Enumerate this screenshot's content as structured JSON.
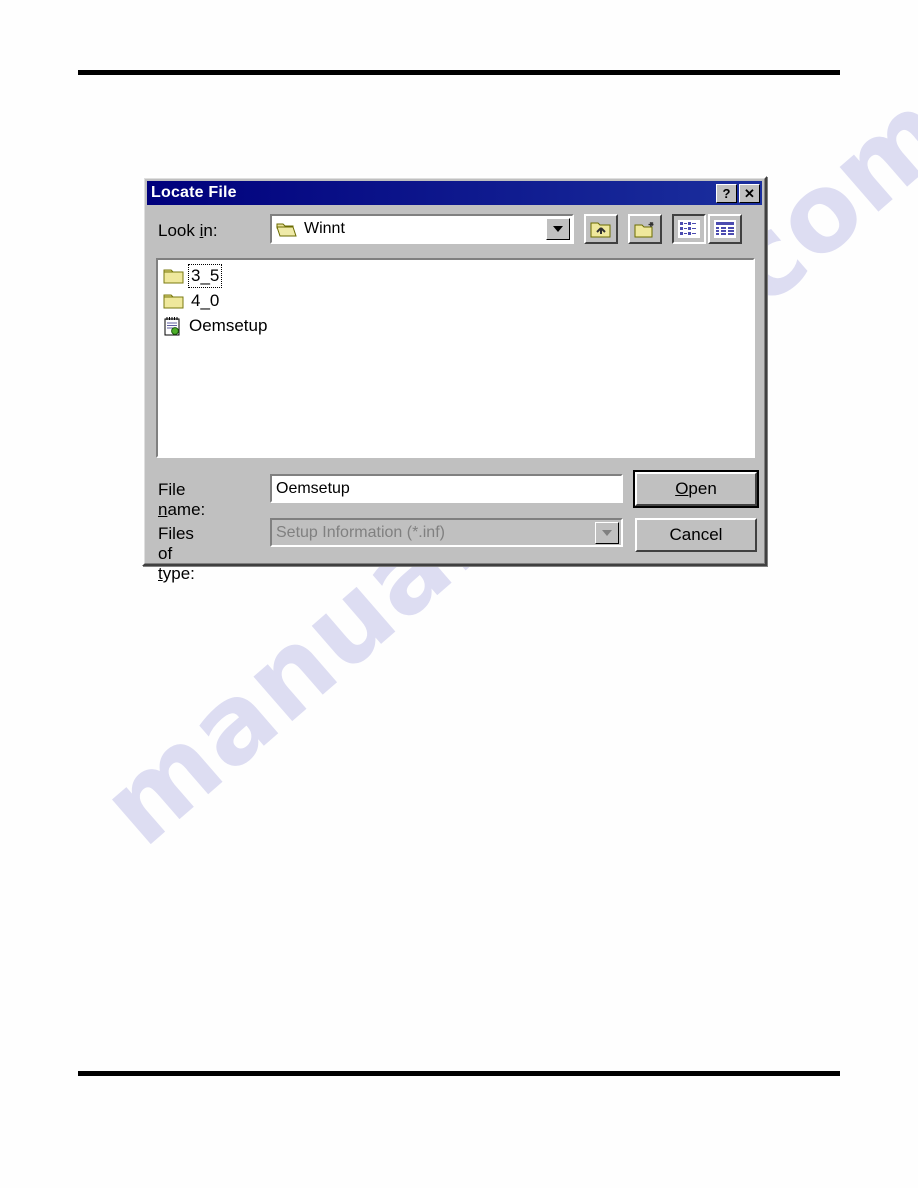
{
  "page": {
    "background_color": "#fefefe",
    "rule_color": "#000000",
    "watermark_text": "manualshive.com",
    "watermark_color": "#c9c9ec"
  },
  "dialog": {
    "title": "Locate File",
    "titlebar_color": "#000080",
    "face_color": "#c0c0c0",
    "titlebar_buttons": [
      {
        "label": "?",
        "name": "help-button"
      },
      {
        "label": "✕",
        "name": "close-button"
      }
    ],
    "lookin": {
      "label_before": "Look ",
      "label_accel": "i",
      "label_after": "n:",
      "value": "Winnt",
      "icon": "open-folder-icon"
    },
    "toolbar": [
      {
        "name": "up-one-level-button",
        "icon": "up-folder-icon",
        "pressed": false
      },
      {
        "name": "create-new-folder-button",
        "icon": "new-folder-icon",
        "pressed": false
      },
      {
        "name": "list-view-button",
        "icon": "list-view-icon",
        "pressed": true
      },
      {
        "name": "details-view-button",
        "icon": "details-view-icon",
        "pressed": false
      }
    ],
    "files": [
      {
        "label": "3_5",
        "icon": "folder-icon",
        "focused": true
      },
      {
        "label": "4_0",
        "icon": "folder-icon",
        "focused": false
      },
      {
        "label": "Oemsetup",
        "icon": "inf-file-icon",
        "focused": false
      }
    ],
    "filename": {
      "label_before": "File ",
      "label_accel": "n",
      "label_after": "ame:",
      "value": "Oemsetup"
    },
    "filetype": {
      "label_before": "Files of ",
      "label_accel": "t",
      "label_after": "ype:",
      "value": "Setup Information (*.inf)",
      "disabled": true
    },
    "buttons": {
      "open_before": "",
      "open_accel": "O",
      "open_after": "pen",
      "cancel_label": "Cancel"
    }
  }
}
